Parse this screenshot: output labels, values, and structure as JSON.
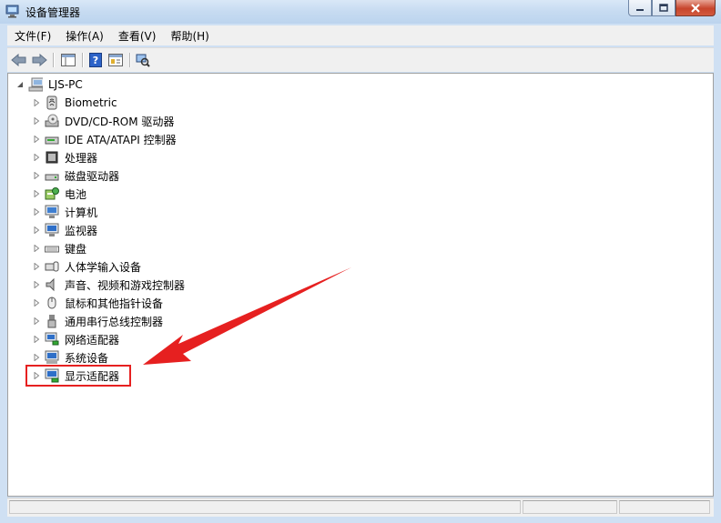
{
  "window": {
    "title": "设备管理器"
  },
  "menu": {
    "items": [
      "文件(F)",
      "操作(A)",
      "查看(V)",
      "帮助(H)"
    ]
  },
  "tree": {
    "root": "LJS-PC",
    "children": [
      {
        "label": "Biometric",
        "icon": "fingerprint-icon"
      },
      {
        "label": "DVD/CD-ROM 驱动器",
        "icon": "dvd-drive-icon"
      },
      {
        "label": "IDE ATA/ATAPI 控制器",
        "icon": "ide-controller-icon"
      },
      {
        "label": "处理器",
        "icon": "processor-icon"
      },
      {
        "label": "磁盘驱动器",
        "icon": "disk-drive-icon"
      },
      {
        "label": "电池",
        "icon": "battery-icon"
      },
      {
        "label": "计算机",
        "icon": "computer-icon"
      },
      {
        "label": "监视器",
        "icon": "monitor-icon"
      },
      {
        "label": "键盘",
        "icon": "keyboard-icon"
      },
      {
        "label": "人体学输入设备",
        "icon": "hid-icon"
      },
      {
        "label": "声音、视频和游戏控制器",
        "icon": "speaker-icon"
      },
      {
        "label": "鼠标和其他指针设备",
        "icon": "mouse-icon"
      },
      {
        "label": "通用串行总线控制器",
        "icon": "usb-icon"
      },
      {
        "label": "网络适配器",
        "icon": "network-adapter-icon"
      },
      {
        "label": "系统设备",
        "icon": "system-device-icon"
      },
      {
        "label": "显示适配器",
        "icon": "display-adapter-icon"
      }
    ]
  },
  "annotation": {
    "color": "#e62020"
  }
}
